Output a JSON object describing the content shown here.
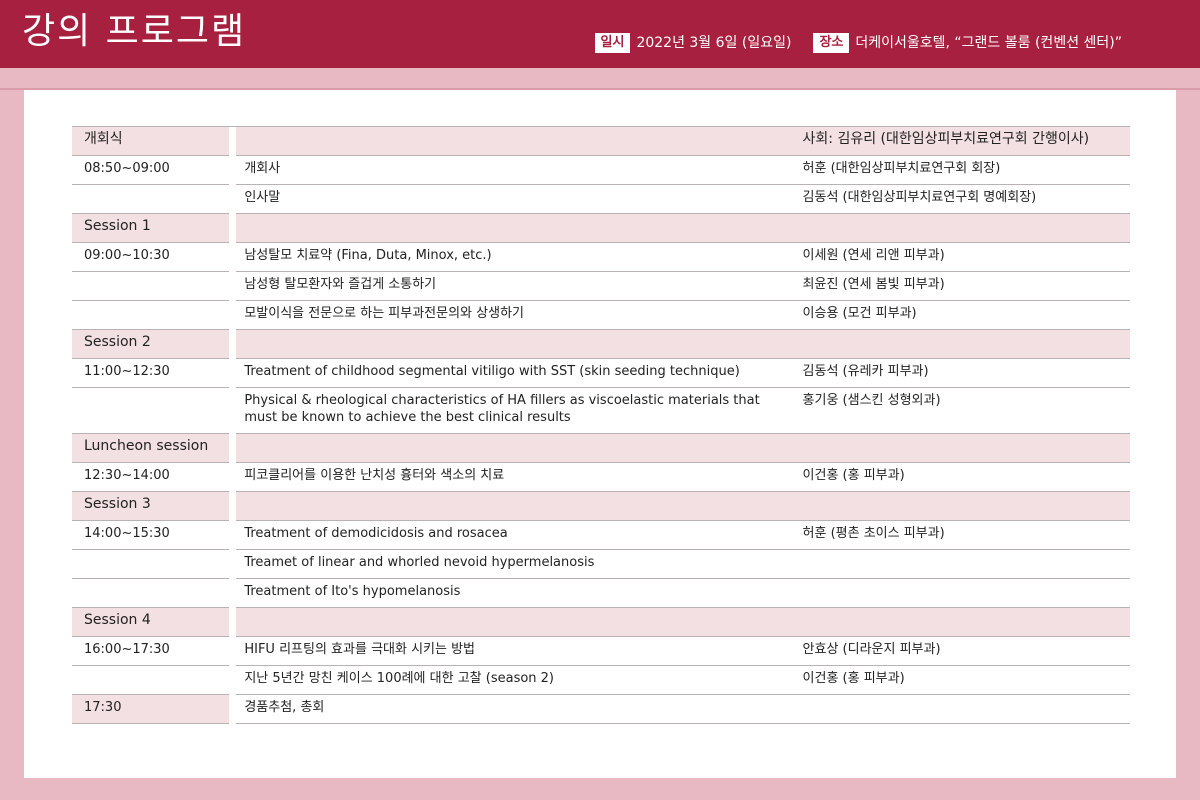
{
  "header": {
    "title": "강의 프로그램",
    "date_tag": "일시",
    "date_value": "2022년 3월 6일 (일요일)",
    "venue_tag": "장소",
    "venue_value": "더케이서울호텔, “그랜드 볼룸 (컨벤션 센터)”"
  },
  "program": {
    "opening": {
      "label": "개회식",
      "mc": "사회: 김유리 (대한임상피부치료연구회 간행이사)",
      "time": "08:50~09:00",
      "items": [
        {
          "title": "개회사",
          "speaker": "허훈 (대한임상피부치료연구회 회장)"
        },
        {
          "title": "인사말",
          "speaker": "김동석 (대한임상피부치료연구회 명예회장)"
        }
      ]
    },
    "session1": {
      "label": "Session 1",
      "time": "09:00~10:30",
      "items": [
        {
          "title": "남성탈모 치료약 (Fina, Duta, Minox, etc.)",
          "speaker": "이세원 (연세 리앤 피부과)"
        },
        {
          "title": "남성형 탈모환자와 즐겁게 소통하기",
          "speaker": "최윤진 (연세 봄빛 피부과)"
        },
        {
          "title": "모발이식을 전문으로 하는 피부과전문의와 상생하기",
          "speaker": "이승용 (모건 피부과)"
        }
      ]
    },
    "session2": {
      "label": "Session 2",
      "time": "11:00~12:30",
      "items": [
        {
          "title": "Treatment of childhood segmental vitiligo with SST (skin seeding technique)",
          "speaker": "김동석 (유레카 피부과)"
        },
        {
          "title": "Physical & rheological characteristics of HA fillers as viscoelastic materials that must be known to achieve the best clinical results",
          "speaker": "홍기웅 (샘스킨 성형외과)"
        }
      ]
    },
    "luncheon": {
      "label": "Luncheon session",
      "time": "12:30~14:00",
      "items": [
        {
          "title": "피코클리어를 이용한 난치성 흉터와 색소의 치료",
          "speaker": "이건홍 (홍 피부과)"
        }
      ]
    },
    "session3": {
      "label": "Session 3",
      "time": "14:00~15:30",
      "items": [
        {
          "title": "Treatment of demodicidosis and rosacea",
          "speaker": "허훈 (평촌 초이스 피부과)"
        },
        {
          "title": "Treamet of linear and whorled nevoid hypermelanosis",
          "speaker": ""
        },
        {
          "title": "Treatment of Ito's hypomelanosis",
          "speaker": ""
        }
      ]
    },
    "session4": {
      "label": "Session 4",
      "time": "16:00~17:30",
      "items": [
        {
          "title": "HIFU 리프팅의 효과를 극대화 시키는 방법",
          "speaker": "안효상 (디라운지 피부과)"
        },
        {
          "title": "지난 5년간 망친 케이스 100례에 대한 고찰 (season 2)",
          "speaker": "이건홍 (홍 피부과)"
        }
      ]
    },
    "closing": {
      "time": "17:30",
      "title": "경품추첨, 총회"
    }
  }
}
